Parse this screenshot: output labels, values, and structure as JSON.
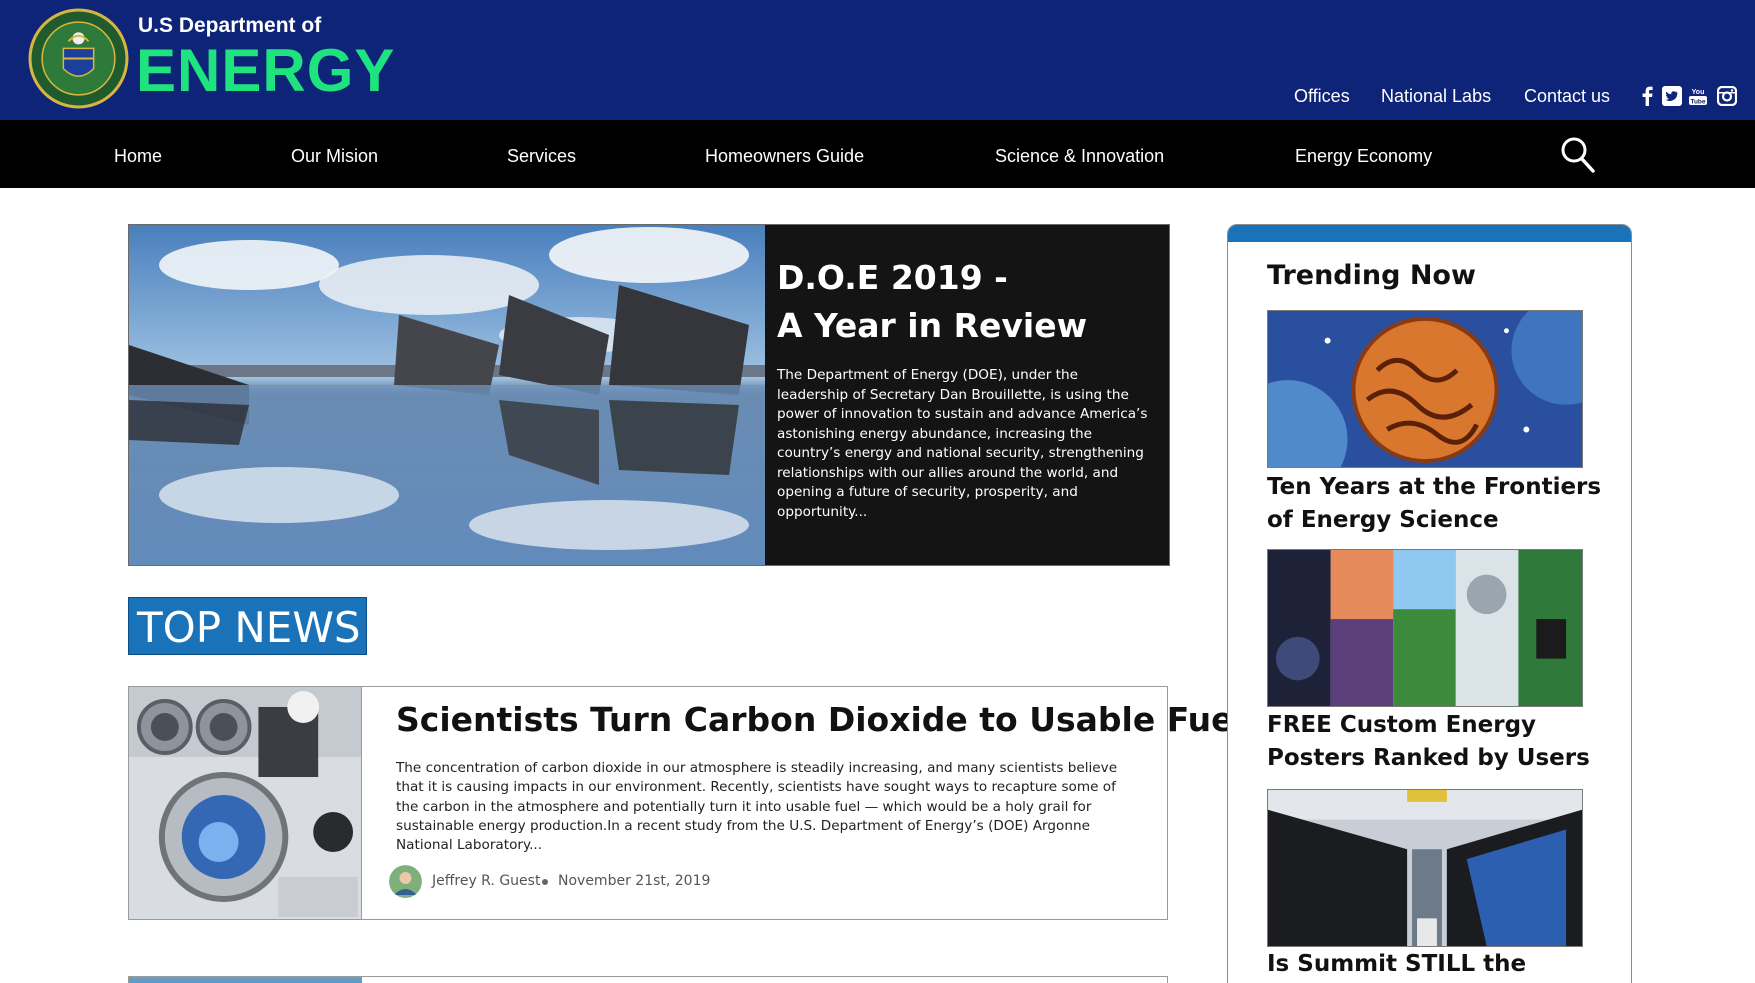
{
  "brand": {
    "line1": "U.S Department of",
    "line2": "ENERGY",
    "colors": {
      "header_bg": "#0e2479",
      "brand_green": "#1fe37f",
      "nav_bg": "#000000",
      "accent_blue": "#1a73b8"
    }
  },
  "top_links": [
    "Offices",
    "National Labs",
    "Contact us"
  ],
  "social_icons": [
    "facebook-icon",
    "twitter-icon",
    "youtube-icon",
    "instagram-icon"
  ],
  "nav": {
    "items": [
      "Home",
      "Our Mision",
      "Services",
      "Homeowners Guide",
      "Science & Innovation",
      "Energy Economy"
    ],
    "search_icon": "search-icon"
  },
  "hero": {
    "title_line1": "D.O.E 2019 -",
    "title_line2": "A Year in Review",
    "body": "The Department of Energy (DOE), under the leadership of Secretary Dan Brouillette, is using the power of innovation to sustain and advance America’s astonishing energy abundance, increasing the country’s energy and national security, strengthening relationships with our allies around the world, and opening a future of security, prosperity, and opportunity..."
  },
  "section_label": "TOP NEWS",
  "articles": [
    {
      "title": "Scientists Turn Carbon Dioxide to Usable Fuel",
      "excerpt": "The concentration of carbon dioxide in our atmosphere is steadily increasing, and many scientists believe that it is causing impacts in our environment. Recently, scientists have sought ways to recapture some of the carbon in the atmosphere and potentially turn it into usable fuel — which would be a holy grail for sustainable energy production.In a recent study from the U.S. Department of Energy’s (DOE) Argonne National Laboratory...",
      "author": "Jeffrey R. Guest",
      "date": "November 21st, 2019"
    }
  ],
  "trending": {
    "title": "Trending Now",
    "items": [
      {
        "caption_line1": "Ten Years at the Frontiers",
        "caption_line2": "of Energy Science"
      },
      {
        "caption_line1": "FREE Custom Energy",
        "caption_line2": "Posters Ranked by Users"
      },
      {
        "caption_line1": "Is Summit STILL the fastest",
        "caption_line2": ""
      }
    ]
  }
}
